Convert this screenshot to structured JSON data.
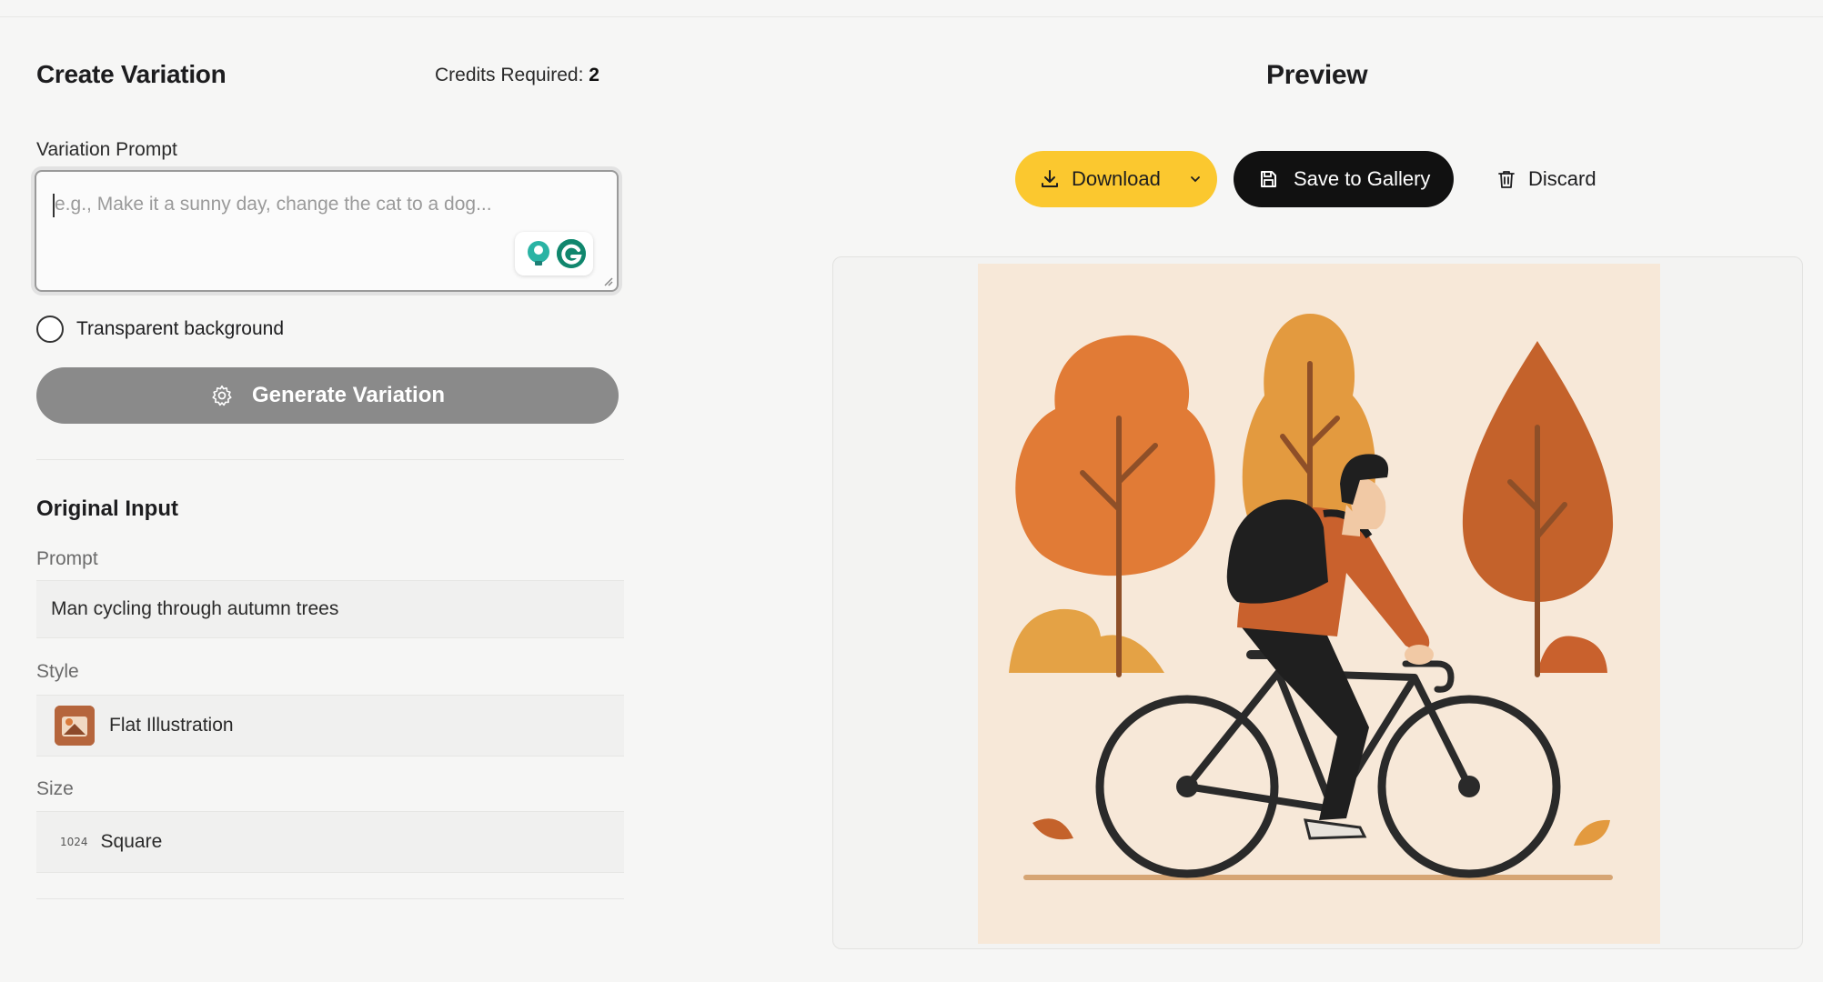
{
  "create": {
    "title": "Create Variation",
    "credits_label": "Credits Required:",
    "credits_value": "2",
    "prompt_label": "Variation Prompt",
    "prompt_placeholder": "e.g., Make it a sunny day, change the cat to a dog...",
    "transparent_label": "Transparent background",
    "transparent_checked": false,
    "generate_label": "Generate Variation"
  },
  "original": {
    "title": "Original Input",
    "prompt_label": "Prompt",
    "prompt_value": "Man cycling through autumn trees",
    "style_label": "Style",
    "style_value": "Flat Illustration",
    "size_label": "Size",
    "size_badge": "1024",
    "size_value": "Square"
  },
  "preview": {
    "title": "Preview",
    "download_label": "Download",
    "save_label": "Save to Gallery",
    "discard_label": "Discard"
  },
  "colors": {
    "download_bg": "#fbc82f",
    "save_bg": "#111111",
    "generate_bg": "#8a8a8a"
  },
  "icons": [
    "lightbulb-icon",
    "grammarly-icon",
    "gear-icon",
    "download-icon",
    "chevron-down-icon",
    "save-icon",
    "trash-icon"
  ]
}
